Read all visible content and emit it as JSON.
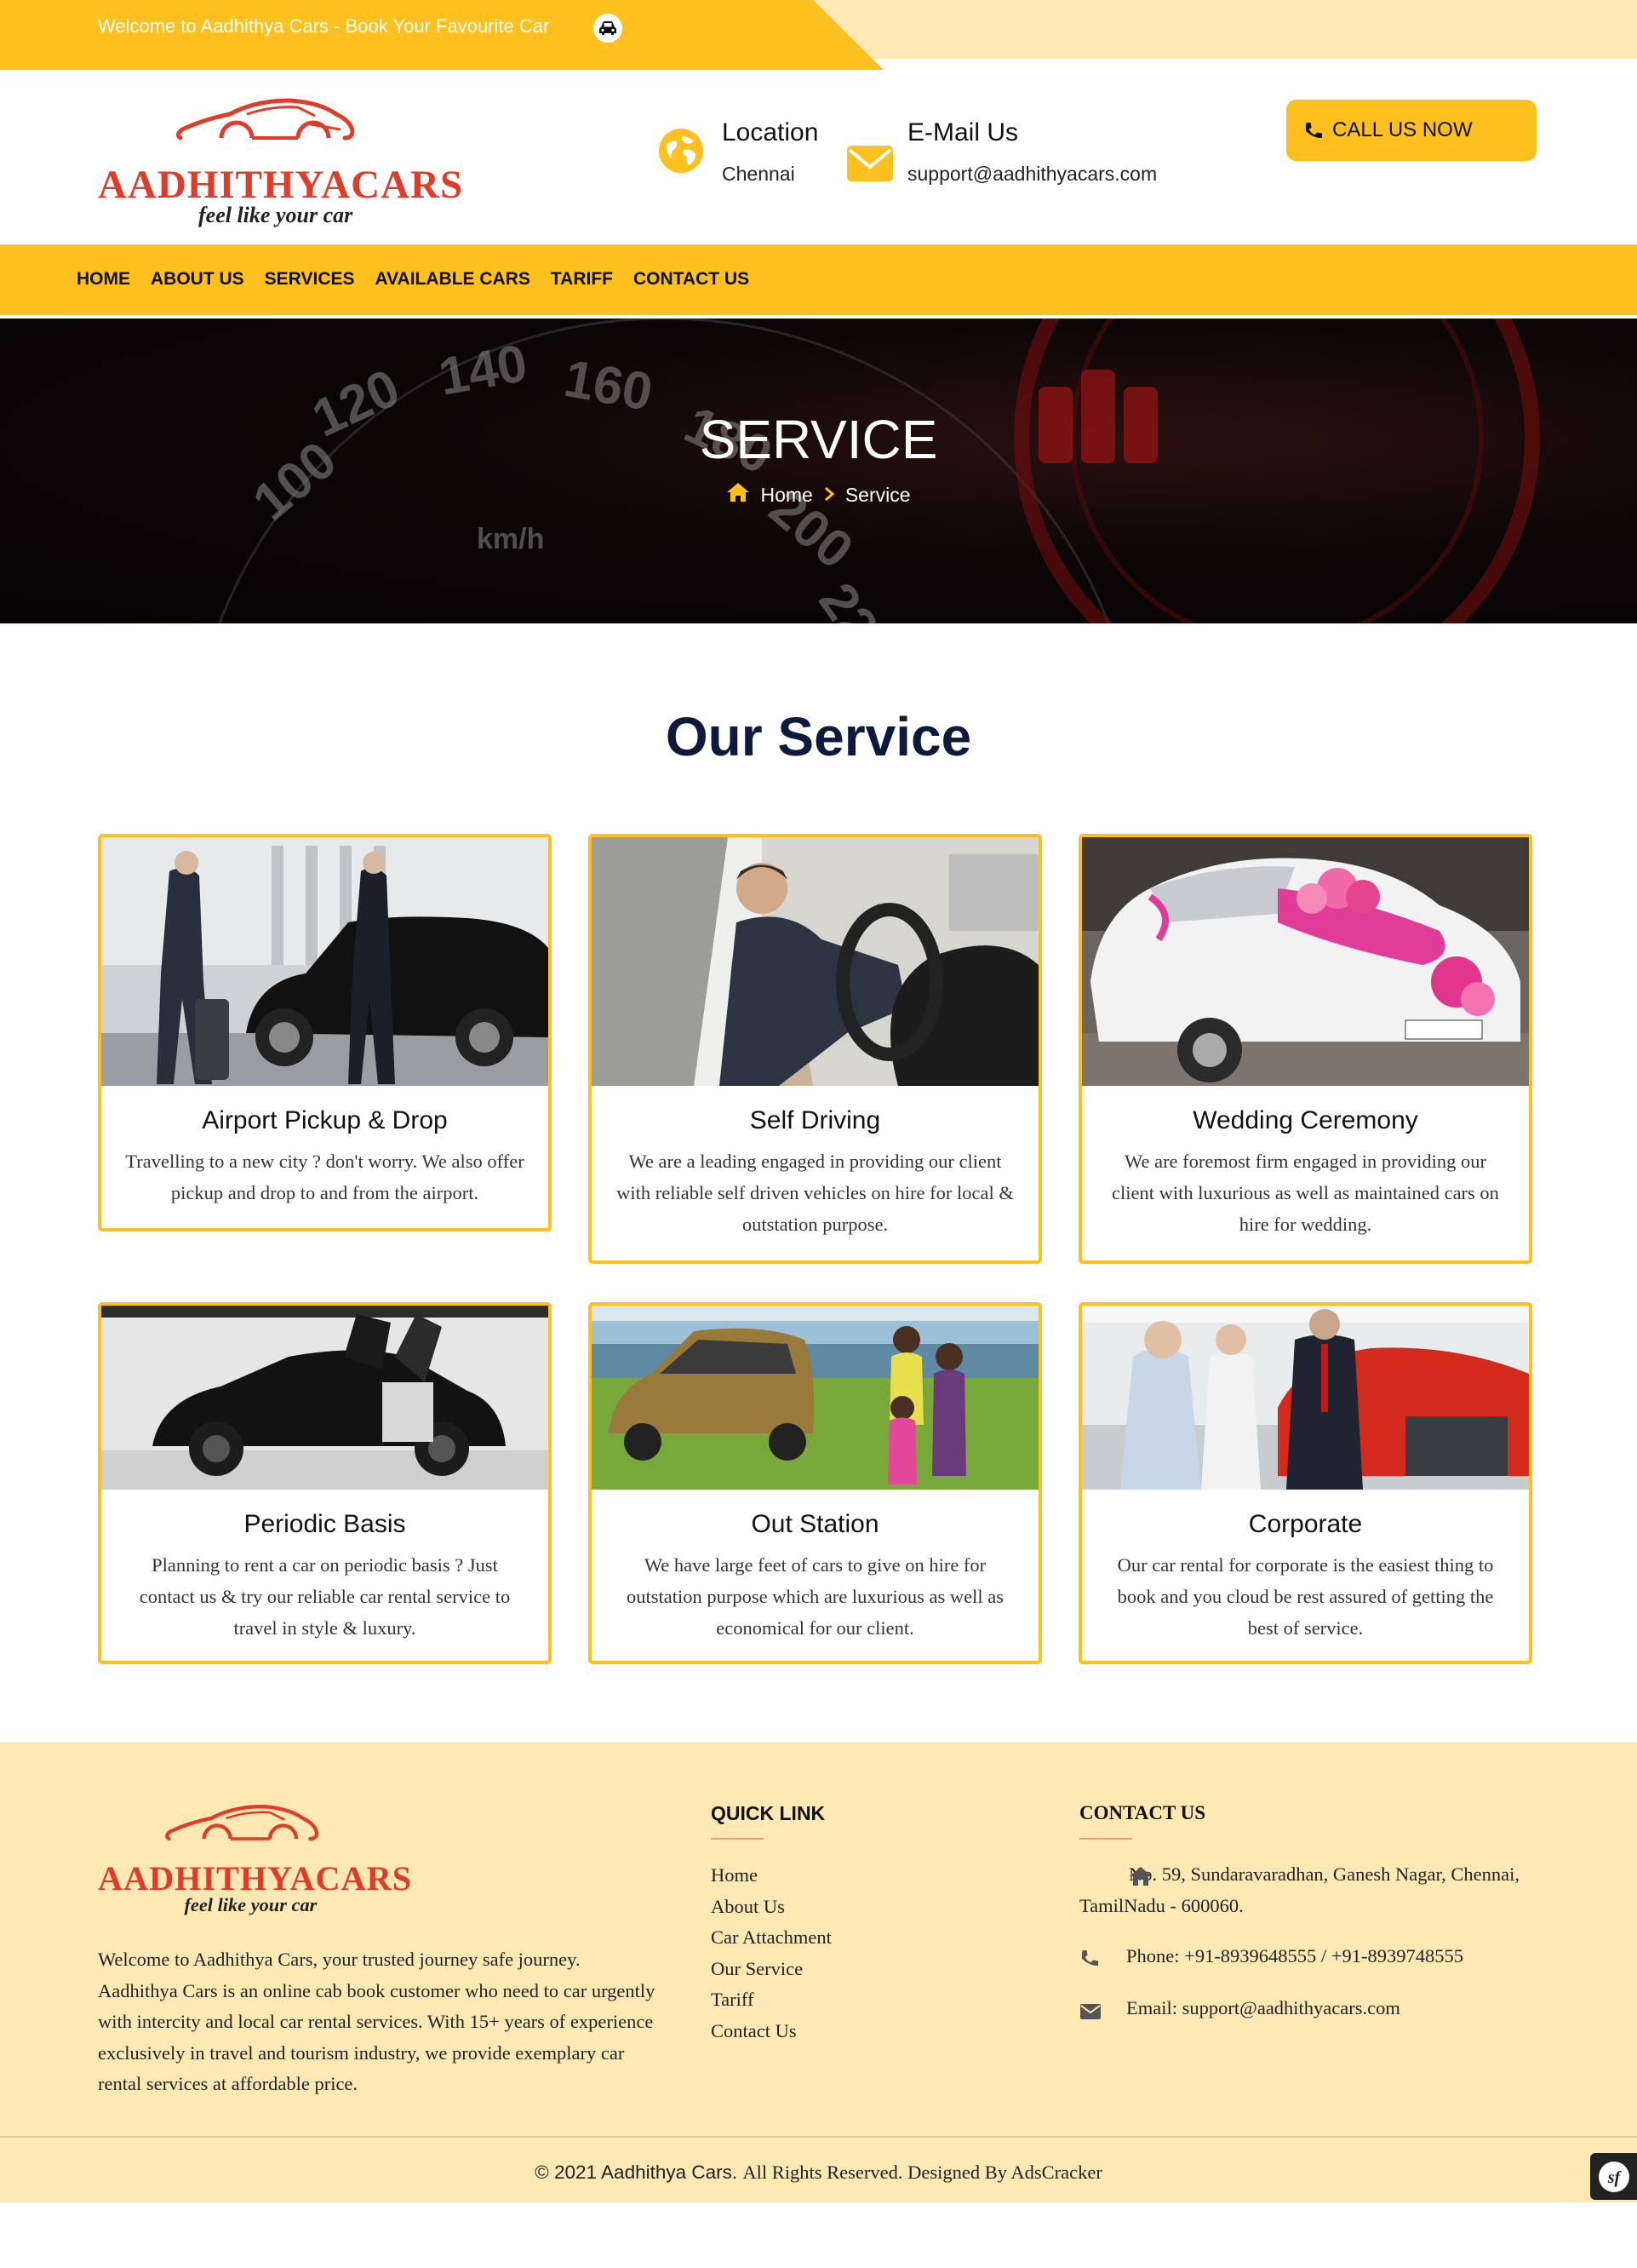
{
  "topbar": {
    "welcome": "Welcome to Aadhithya Cars - Book Your Favourite Car"
  },
  "header": {
    "logo_text": "AADHITHYACARS",
    "tagline": "feel like your car",
    "location_title": "Location",
    "location_value": "Chennai",
    "email_title": "E-Mail Us",
    "email_value": "support@aadhithyacars.com",
    "call_label": "CALL US NOW"
  },
  "nav": {
    "items": [
      "HOME",
      "ABOUT US",
      "SERVICES",
      "AVAILABLE CARS",
      "TARIFF",
      "CONTACT US"
    ]
  },
  "hero": {
    "title": "SERVICE",
    "crumb_home": "Home",
    "crumb_current": "Service"
  },
  "services": {
    "title": "Our Service",
    "cards": [
      {
        "name": "Airport Pickup & Drop",
        "desc": "Travelling to a new city ? don't worry. We also offer pickup and drop to and from the airport."
      },
      {
        "name": "Self Driving",
        "desc": "We are a leading engaged in providing our client with reliable self driven vehicles on hire for local & outstation purpose."
      },
      {
        "name": "Wedding Ceremony",
        "desc": "We are foremost firm engaged in providing our client with luxurious as well as maintained cars on hire for wedding."
      },
      {
        "name": "Periodic Basis",
        "desc": "Planning to rent a car on periodic basis ? Just contact us & try our reliable car rental service to travel in style & luxury."
      },
      {
        "name": "Out Station",
        "desc": "We have large feet of cars to give on hire for outstation purpose which are luxurious as well as economical for our client."
      },
      {
        "name": "Corporate",
        "desc": "Our car rental for corporate is the easiest thing to book and you cloud be rest assured of getting the best of service."
      }
    ]
  },
  "footer": {
    "logo_text": "AADHITHYACARS",
    "tagline": "feel like your car",
    "about": "Welcome to Aadhithya Cars, your trusted journey safe journey. Aadhithya Cars is an online cab book customer who need to car urgently with intercity and local car rental services. With 15+ years of experience exclusively in travel and tourism industry, we provide exemplary car rental services at affordable price.",
    "quick_link_title": "QUICK LINK",
    "quick_links": [
      "Home",
      "About Us",
      "Car Attachment",
      "Our Service",
      "Tariff",
      "Contact Us"
    ],
    "contact_title": "CONTACT US",
    "address": "No. 59, Sundaravaradhan, Ganesh Nagar, Chennai, TamilNadu - 600060.",
    "phone": "Phone: +91-8939648555 / +91-8939748555",
    "email": "Email: support@aadhithyacars.com",
    "copyright_prefix": "© 2021 Aadhithya Cars.",
    "copyright_suffix": "All Rights Reserved. Designed By AdsCracker"
  },
  "colors": {
    "accent": "#fdc01e",
    "accent_light": "#fee9b4",
    "logo_red": "#e23b27",
    "heading_navy": "#0e1a3d"
  },
  "icons": [
    "car-icon",
    "globe-icon",
    "mail-icon",
    "phone-icon",
    "home-icon",
    "chevron-right-icon",
    "map-marker-icon",
    "symfony-icon"
  ]
}
